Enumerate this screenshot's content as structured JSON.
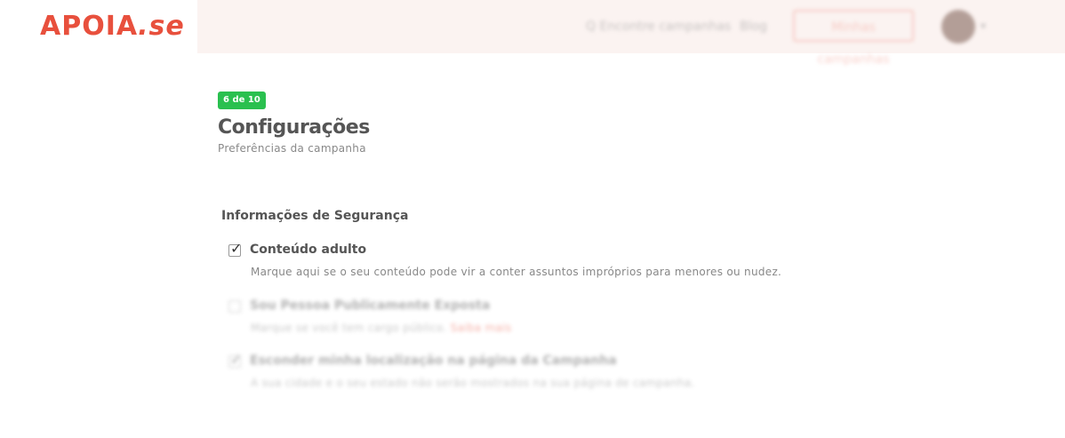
{
  "header": {
    "logo_main": "APOIA",
    "logo_suffix": ".se",
    "nav_explore": "Q Encontre campanhas",
    "nav_blog": "Blog",
    "create_button": "Minhas campanhas"
  },
  "step": {
    "badge": "6 de 10",
    "title": "Configurações",
    "subtitle": "Preferências da campanha"
  },
  "section": {
    "title": "Informações de Segurança",
    "options": [
      {
        "label": "Conteúdo adulto",
        "description": "Marque aqui se o seu conteúdo pode vir a conter assuntos impróprios para menores ou nudez.",
        "checked": true
      },
      {
        "label": "Sou Pessoa Publicamente Exposta",
        "description": "Marque se você tem cargo público.",
        "link": "Saiba mais",
        "checked": false
      },
      {
        "label": "Esconder minha localização na página da Campanha",
        "description": "A sua cidade e o seu estado não serão mostrados na sua página de campanha.",
        "checked": true
      }
    ]
  },
  "colors": {
    "brand": "#e8503d",
    "badge": "#2ac04f",
    "topbar_bg": "#fbf3f1"
  }
}
